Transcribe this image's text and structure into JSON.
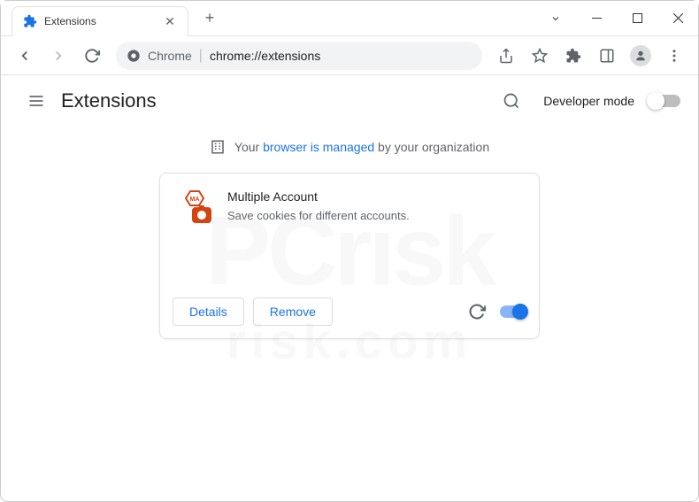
{
  "tab": {
    "title": "Extensions"
  },
  "toolbar": {
    "url_label": "Chrome",
    "url_path": "chrome://extensions"
  },
  "header": {
    "title": "Extensions",
    "dev_mode": "Developer mode"
  },
  "managed": {
    "prefix": "Your ",
    "link": "browser is managed",
    "suffix": " by your organization"
  },
  "extension": {
    "name": "Multiple Account",
    "description": "Save cookies for different accounts.",
    "icon_badge": "MA",
    "details_label": "Details",
    "remove_label": "Remove",
    "enabled": true
  },
  "watermark": {
    "main": "PCrisk",
    "sub": "risk.com"
  }
}
